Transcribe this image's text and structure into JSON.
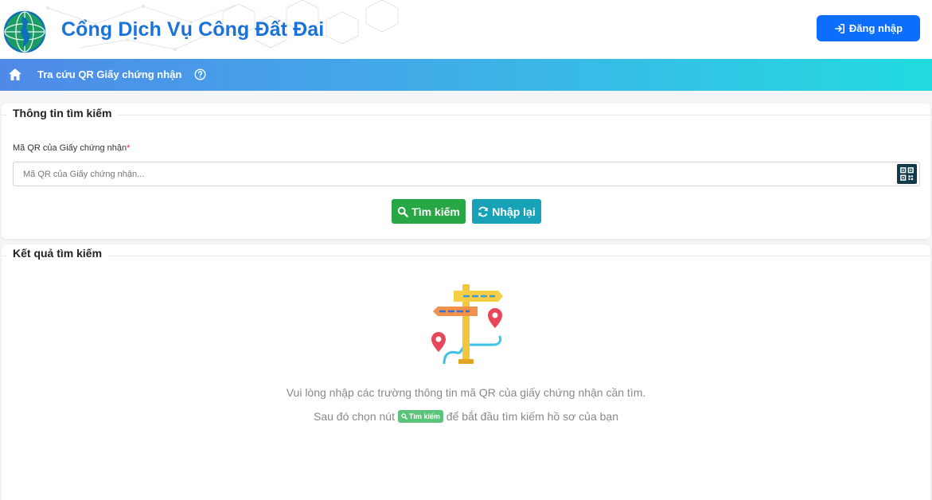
{
  "header": {
    "title": "Cổng Dịch Vụ Công Đất Đai",
    "login_label": "Đăng nhập",
    "logo_icon": "vietnam-globe-logo"
  },
  "nav": {
    "home_icon": "home-icon",
    "link_label": "Tra cứu QR Giấy chứng nhận",
    "help_icon": "question-circle-icon"
  },
  "search": {
    "section_title": "Thông tin tìm kiếm",
    "field_label": "Mã QR của Giấy chứng nhận",
    "required_mark": "*",
    "input_value": "",
    "input_placeholder": "Mã QR của Giấy chứng nhận...",
    "search_label": "Tìm kiếm",
    "reset_label": "Nhập lại"
  },
  "results": {
    "section_title": "Kết quả tìm kiếm",
    "empty_line1": "Vui lòng nhập các trường thông tin mã QR của giấy chứng nhận cần tìm.",
    "empty_line2_before": "Sau đó chọn nút",
    "empty_badge": "Tìm kiếm",
    "empty_line2_after": "để bắt đầu tìm kiếm hồ sơ của bạn"
  },
  "colors": {
    "brand": "#1a73d9",
    "login_button": "#0d6efd",
    "search_button": "#28a745",
    "reset_button": "#17a2b8",
    "nav_gradient_start": "#4f8ae8",
    "nav_gradient_end": "#22dbe0"
  }
}
